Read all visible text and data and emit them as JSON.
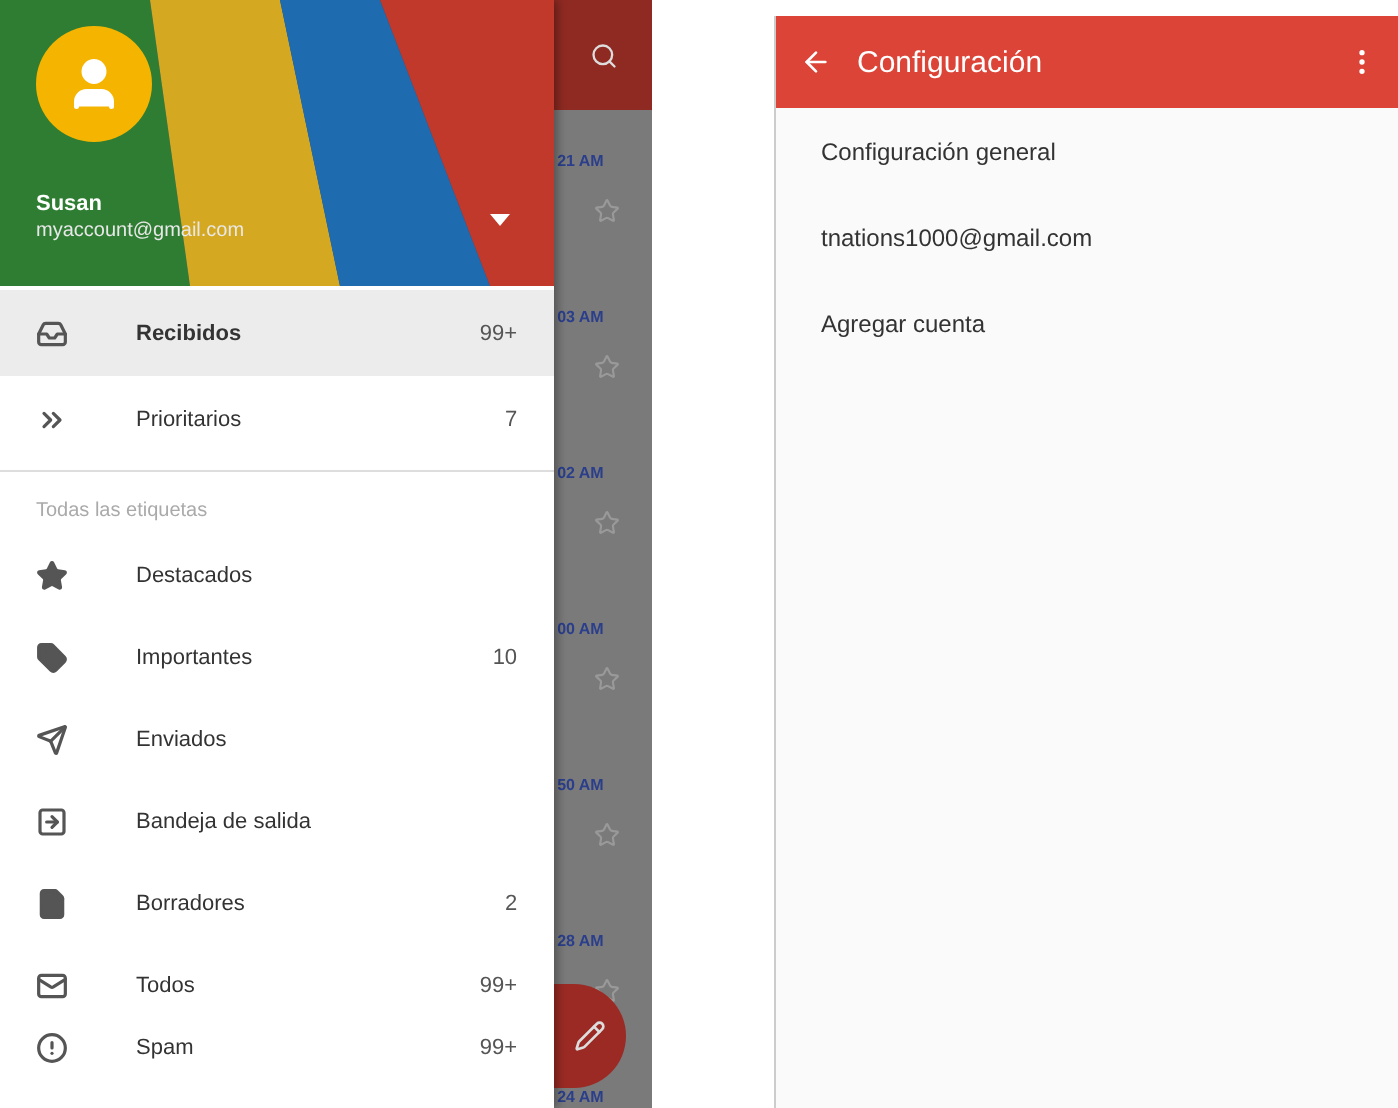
{
  "drawer": {
    "account": {
      "name": "Susan",
      "email": "myaccount@gmail.com"
    },
    "items": [
      {
        "kind": "inbox",
        "label": "Recibidos",
        "count": "99+",
        "selected": true
      },
      {
        "kind": "priority",
        "label": "Prioritarios",
        "count": "7",
        "selected": false
      }
    ],
    "section_label": "Todas las etiquetas",
    "labels": [
      {
        "kind": "starred",
        "label": "Destacados",
        "selected": false
      },
      {
        "kind": "important",
        "label": "Importantes",
        "count": "10",
        "selected": false
      },
      {
        "kind": "sent",
        "label": "Enviados",
        "selected": false
      },
      {
        "kind": "outbox",
        "label": "Bandeja de salida",
        "selected": false
      },
      {
        "kind": "drafts",
        "label": "Borradores",
        "count": "2",
        "selected": false
      },
      {
        "kind": "all",
        "label": "Todos",
        "count": "99+",
        "selected": false
      },
      {
        "kind": "spam",
        "label": "Spam",
        "count": "99+",
        "selected": false
      }
    ]
  },
  "mail_list": {
    "times": [
      "21 AM",
      "03 AM",
      "02 AM",
      "00 AM",
      "50 AM",
      "28 AM",
      "24 AM"
    ]
  },
  "settings": {
    "title": "Configuración",
    "items": [
      "Configuración general",
      "tnations1000@gmail.com",
      "Agregar cuenta"
    ]
  }
}
